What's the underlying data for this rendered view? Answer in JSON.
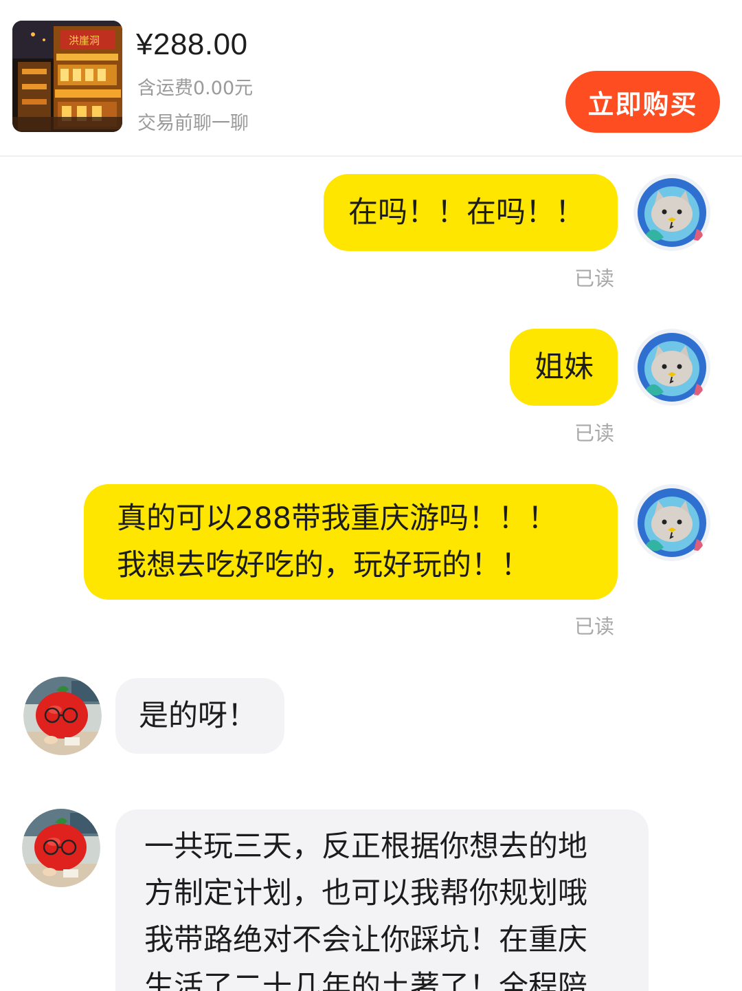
{
  "product": {
    "thumbnail": "chongqing-hongyadong-night-photo",
    "thumbnail_sign": "洪崖洞",
    "price": "¥288.00",
    "shipping": "含运费0.00元",
    "chat_hint": "交易前聊一聊",
    "buy_label": "立即购买"
  },
  "messages": [
    {
      "sender": "me",
      "text": "在吗！！在吗！！",
      "status": "已读"
    },
    {
      "sender": "me",
      "text": "姐妹",
      "status": "已读"
    },
    {
      "sender": "me",
      "lines": [
        "真的可以288带我重庆游吗！！！",
        "我想去吃好吃的，玩好玩的！！"
      ],
      "status": "已读"
    },
    {
      "sender": "them",
      "text": "是的呀！"
    },
    {
      "sender": "them",
      "lines": [
        "一共玩三天，反正根据你想去的地",
        "方制定计划，也可以我帮你规划哦",
        "我带路绝对不会让你踩坑！在重庆",
        "生活了二十几年的土著了！全程陪"
      ]
    }
  ],
  "icons": {
    "my_avatar": "cat-astronaut-avatar-icon",
    "their_avatar": "red-apple-plush-avatar-icon"
  },
  "colors": {
    "buy_button": "#ff4d22",
    "my_bubble": "#fee600",
    "their_bubble": "#f3f3f5",
    "read_status": "#a8a8a8"
  }
}
